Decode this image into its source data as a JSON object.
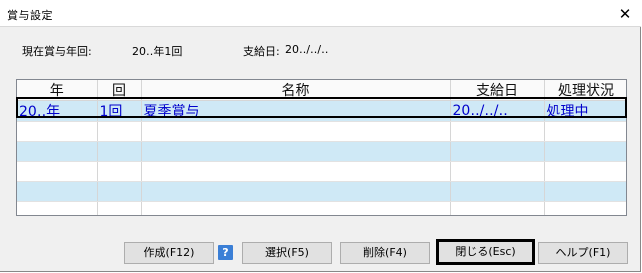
{
  "window": {
    "title": "賞与設定",
    "close_glyph": "✕"
  },
  "info": {
    "current_label": "現在賞与年回:",
    "current_value": "20‥年1回",
    "pay_date_label": "支給日:",
    "pay_date_value": "20‥/‥/‥"
  },
  "table": {
    "columns": [
      "年",
      "回",
      "名称",
      "支給日",
      "処理状況"
    ],
    "rows": [
      [
        "20‥年",
        "1回",
        "夏季賞与",
        "20‥/‥/‥",
        "処理中"
      ],
      [
        "",
        "",
        "",
        "",
        ""
      ],
      [
        "",
        "",
        "",
        "",
        ""
      ],
      [
        "",
        "",
        "",
        "",
        ""
      ],
      [
        "",
        "",
        "",
        "",
        ""
      ],
      [
        "",
        "",
        "",
        "",
        ""
      ]
    ]
  },
  "buttons": {
    "create": "作成(F12)",
    "help_icon_glyph": "?",
    "select": "選択(F5)",
    "delete": "削除(F4)",
    "close": "閉じる(Esc)",
    "help": "ヘルプ(F1)"
  },
  "colors": {
    "selected_row_text": "#0000cc",
    "alt_row_bg": "#cfe9f6"
  }
}
